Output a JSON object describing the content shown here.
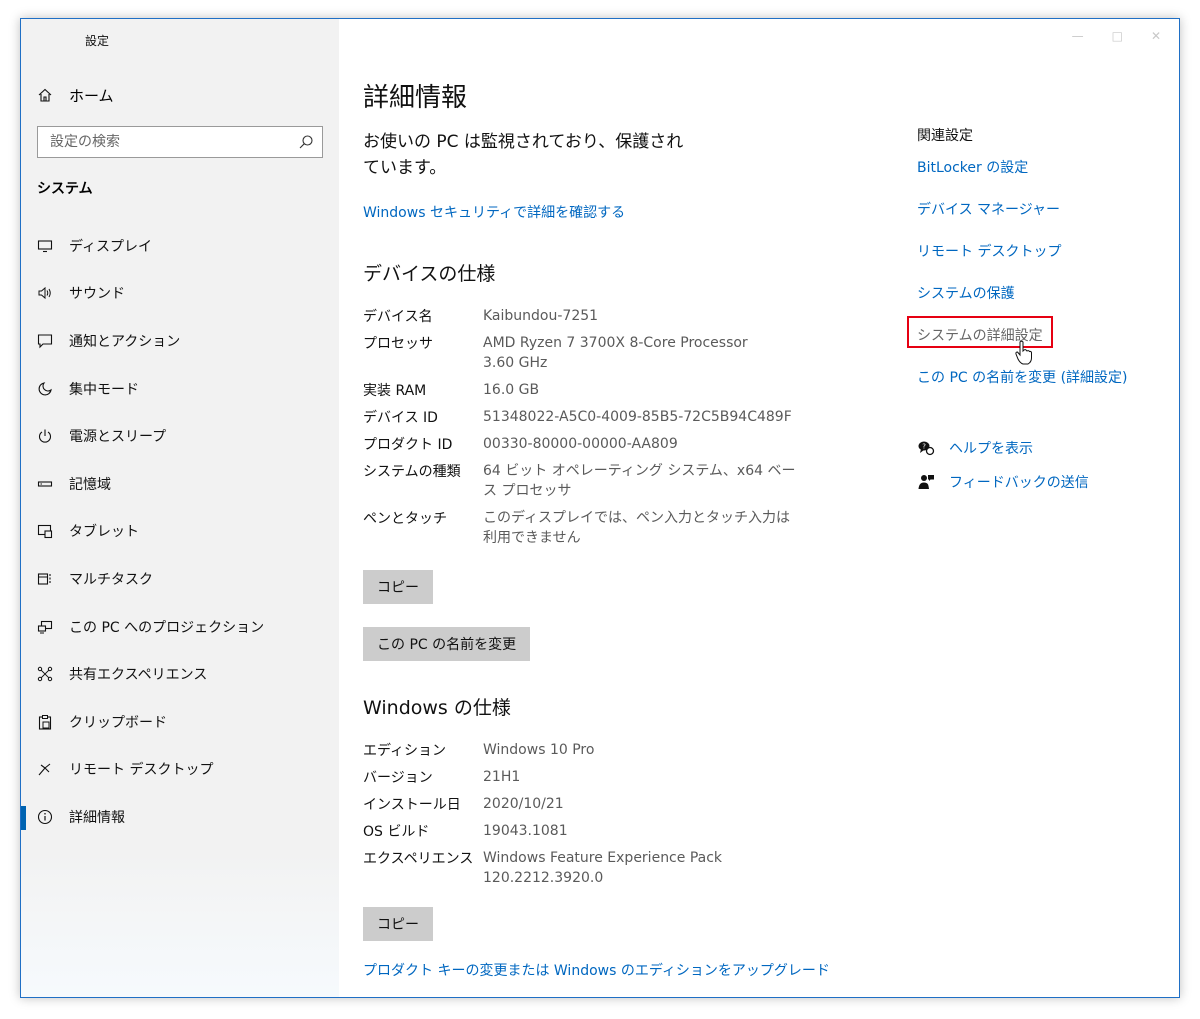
{
  "app": {
    "title": "設定"
  },
  "sidebar": {
    "home_label": "ホーム",
    "search_placeholder": "設定の検索",
    "section": "システム",
    "items": [
      {
        "label": "ディスプレイ",
        "icon": "monitor-icon"
      },
      {
        "label": "サウンド",
        "icon": "speaker-icon"
      },
      {
        "label": "通知とアクション",
        "icon": "notification-icon"
      },
      {
        "label": "集中モード",
        "icon": "moon-icon"
      },
      {
        "label": "電源とスリープ",
        "icon": "power-icon"
      },
      {
        "label": "記憶域",
        "icon": "storage-icon"
      },
      {
        "label": "タブレット",
        "icon": "tablet-icon"
      },
      {
        "label": "マルチタスク",
        "icon": "multitask-icon"
      },
      {
        "label": "この PC へのプロジェクション",
        "icon": "projection-icon"
      },
      {
        "label": "共有エクスペリエンス",
        "icon": "share-icon"
      },
      {
        "label": "クリップボード",
        "icon": "clipboard-icon"
      },
      {
        "label": "リモート デスクトップ",
        "icon": "remote-icon"
      },
      {
        "label": "詳細情報",
        "icon": "info-icon",
        "active": true
      }
    ]
  },
  "main": {
    "title": "詳細情報",
    "protection_text": "お使いの PC は監視されており、保護されています。",
    "security_link": "Windows セキュリティで詳細を確認する",
    "device_spec": {
      "heading": "デバイスの仕様",
      "rows": [
        {
          "key": "デバイス名",
          "value": "Kaibundou-7251"
        },
        {
          "key": "プロセッサ",
          "value": "AMD Ryzen 7 3700X 8-Core Processor 3.60 GHz"
        },
        {
          "key": "実装 RAM",
          "value": "16.0 GB"
        },
        {
          "key": "デバイス ID",
          "value": "51348022-A5C0-4009-85B5-72C5B94C489F"
        },
        {
          "key": "プロダクト ID",
          "value": "00330-80000-00000-AA809"
        },
        {
          "key": "システムの種類",
          "value": "64 ビット オペレーティング システム、x64 ベース プロセッサ"
        },
        {
          "key": "ペンとタッチ",
          "value": "このディスプレイでは、ペン入力とタッチ入力は利用できません"
        }
      ],
      "copy_label": "コピー",
      "rename_label": "この PC の名前を変更"
    },
    "windows_spec": {
      "heading": "Windows の仕様",
      "rows": [
        {
          "key": "エディション",
          "value": "Windows 10 Pro"
        },
        {
          "key": "バージョン",
          "value": "21H1"
        },
        {
          "key": "インストール日",
          "value": "2020/10/21"
        },
        {
          "key": "OS ビルド",
          "value": "19043.1081"
        },
        {
          "key": "エクスペリエンス",
          "value": "Windows Feature Experience Pack 120.2212.3920.0"
        }
      ],
      "copy_label": "コピー"
    },
    "upgrade_link": "プロダクト キーの変更または Windows のエディションをアップグレード"
  },
  "related": {
    "heading": "関連設定",
    "links": [
      "BitLocker の設定",
      "デバイス マネージャー",
      "リモート デスクトップ",
      "システムの保護",
      "システムの詳細設定",
      "この PC の名前を変更 (詳細設定)"
    ],
    "highlighted_index": 4,
    "highlight_color": "#e60012"
  },
  "help": {
    "get_help": "ヘルプを表示",
    "feedback": "フィードバックの送信"
  },
  "colors": {
    "accent": "#0067c0",
    "active_bar": "#0063b1"
  }
}
